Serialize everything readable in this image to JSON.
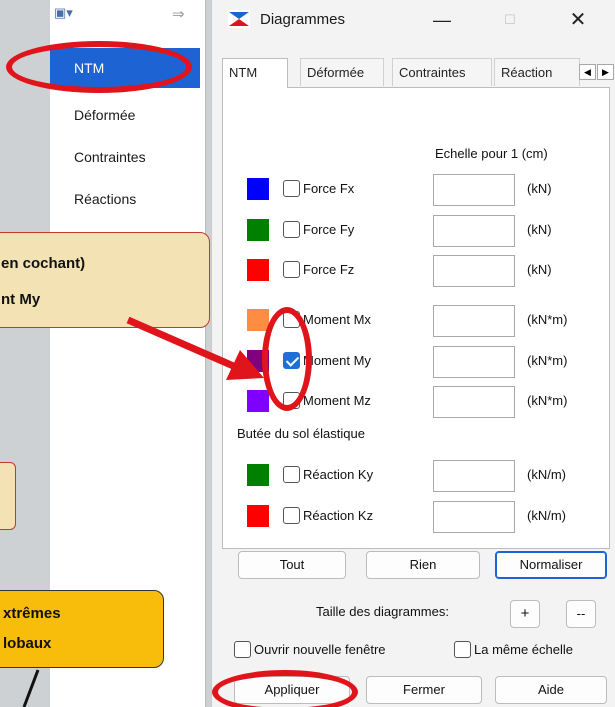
{
  "left_panel": {
    "items": [
      {
        "label": "NTM",
        "selected": true
      },
      {
        "label": "Déformée",
        "selected": false
      },
      {
        "label": "Contraintes",
        "selected": false
      },
      {
        "label": "Réactions",
        "selected": false
      }
    ]
  },
  "annotations": {
    "callout1_line1": "en     cochant)",
    "callout1_line2": "nt My",
    "callout2_line1": "xtrêmes",
    "callout2_line2": "lobaux"
  },
  "dialog": {
    "title": "Diagrammes",
    "tabs": [
      "NTM",
      "Déformée",
      "Contraintes",
      "Réaction"
    ],
    "active_tab": "NTM",
    "scale_header": "Echelle pour 1  (cm)",
    "rows": [
      {
        "label": "Force Fx",
        "unit": "(kN)",
        "color": "#0000ff",
        "checked": false
      },
      {
        "label": "Force Fy",
        "unit": "(kN)",
        "color": "#008000",
        "checked": false
      },
      {
        "label": "Force Fz",
        "unit": "(kN)",
        "color": "#ff0000",
        "checked": false
      },
      {
        "label": "Moment Mx",
        "unit": "(kN*m)",
        "color": "#ff8c42",
        "checked": false
      },
      {
        "label": "Moment My",
        "unit": "(kN*m)",
        "color": "#800080",
        "checked": true
      },
      {
        "label": "Moment Mz",
        "unit": "(kN*m)",
        "color": "#8000ff",
        "checked": false
      }
    ],
    "soil_group_label": "Butée du sol élastique",
    "soil_rows": [
      {
        "label": "Réaction Ky",
        "unit": "(kN/m)",
        "color": "#008000",
        "checked": false
      },
      {
        "label": "Réaction Kz",
        "unit": "(kN/m)",
        "color": "#ff0000",
        "checked": false
      }
    ],
    "buttons": {
      "all": "Tout",
      "none": "Rien",
      "normalize": "Normaliser"
    },
    "size_label": "Taille des diagrammes:",
    "plus": "+",
    "minus": "--",
    "open_new_window": "Ouvrir nouvelle fenêtre",
    "same_scale": "La même échelle",
    "apply": "Appliquer",
    "close": "Fermer",
    "help": "Aide"
  },
  "colors": {
    "accent": "#1e63d3",
    "highlight": "#e0141b"
  }
}
